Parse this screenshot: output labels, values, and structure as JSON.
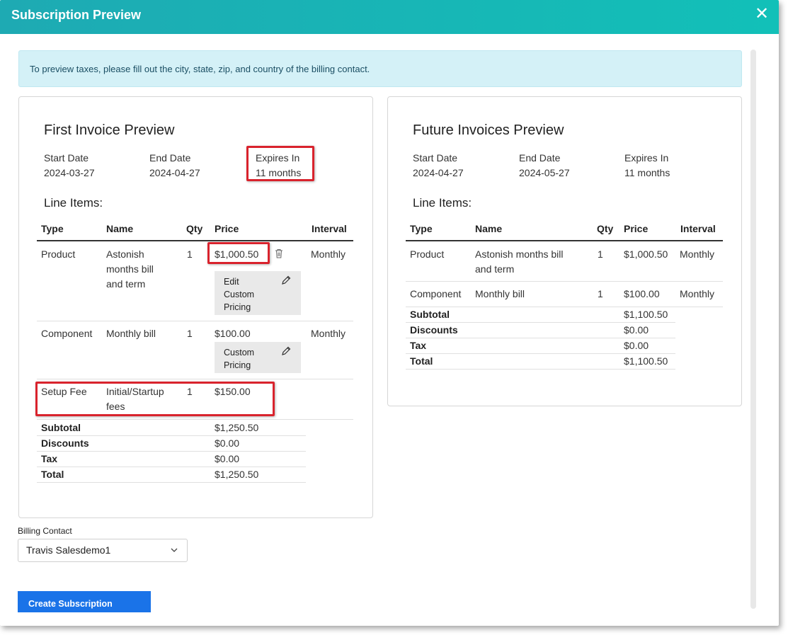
{
  "modal": {
    "title": "Subscription Preview",
    "close": "✕"
  },
  "alert": "To preview taxes, please fill out the city, state, zip, and country of the billing contact.",
  "first": {
    "heading": "First Invoice Preview",
    "start_label": "Start Date",
    "start": "2024-03-27",
    "end_label": "End Date",
    "end": "2024-04-27",
    "expires_label": "Expires In",
    "expires": "11 months",
    "line_items_label": "Line Items:",
    "columns": [
      "Type",
      "Name",
      "Qty",
      "Price",
      "Interval"
    ],
    "rows": [
      {
        "type": "Product",
        "name_lines": [
          "Astonish",
          "months bill",
          "and term"
        ],
        "qty": "1",
        "price": "$1,000.50",
        "interval": "Monthly",
        "pricing_btn": [
          "Edit",
          "Custom",
          "Pricing"
        ]
      },
      {
        "type": "Component",
        "name_lines": [
          "Monthly bill"
        ],
        "qty": "1",
        "price": "$100.00",
        "interval": "Monthly",
        "pricing_btn": [
          "Custom",
          "Pricing"
        ]
      },
      {
        "type": "Setup Fee",
        "name_lines": [
          "Initial/Startup",
          "fees"
        ],
        "qty": "1",
        "price": "$150.00",
        "interval": ""
      }
    ],
    "totals": [
      {
        "label": "Subtotal",
        "value": "$1,250.50"
      },
      {
        "label": "Discounts",
        "value": "$0.00"
      },
      {
        "label": "Tax",
        "value": "$0.00"
      },
      {
        "label": "Total",
        "value": "$1,250.50"
      }
    ]
  },
  "future": {
    "heading": "Future Invoices Preview",
    "start_label": "Start Date",
    "start": "2024-04-27",
    "end_label": "End Date",
    "end": "2024-05-27",
    "expires_label": "Expires In",
    "expires": "11 months",
    "line_items_label": "Line Items:",
    "columns": [
      "Type",
      "Name",
      "Qty",
      "Price",
      "Interval"
    ],
    "rows": [
      {
        "type": "Product",
        "name_lines": [
          "Astonish months bill",
          "and term"
        ],
        "qty": "1",
        "price": "$1,000.50",
        "interval": "Monthly"
      },
      {
        "type": "Component",
        "name_lines": [
          "Monthly bill"
        ],
        "qty": "1",
        "price": "$100.00",
        "interval": "Monthly"
      }
    ],
    "totals": [
      {
        "label": "Subtotal",
        "value": "$1,100.50"
      },
      {
        "label": "Discounts",
        "value": "$0.00"
      },
      {
        "label": "Tax",
        "value": "$0.00"
      },
      {
        "label": "Total",
        "value": "$1,100.50"
      }
    ]
  },
  "billing": {
    "label": "Billing Contact",
    "value": "Travis Salesdemo1"
  },
  "create_button": "Create Subscription",
  "icons": {
    "close": "close-icon",
    "trash": "trash-icon",
    "edit": "pencil-icon",
    "chevron": "chevron-down-icon"
  },
  "colors": {
    "header_start": "#1eaab3",
    "header_end": "#12c0b8",
    "alert_bg": "#d4f1f7",
    "button": "#1a73e8",
    "highlight": "#d9232d"
  }
}
